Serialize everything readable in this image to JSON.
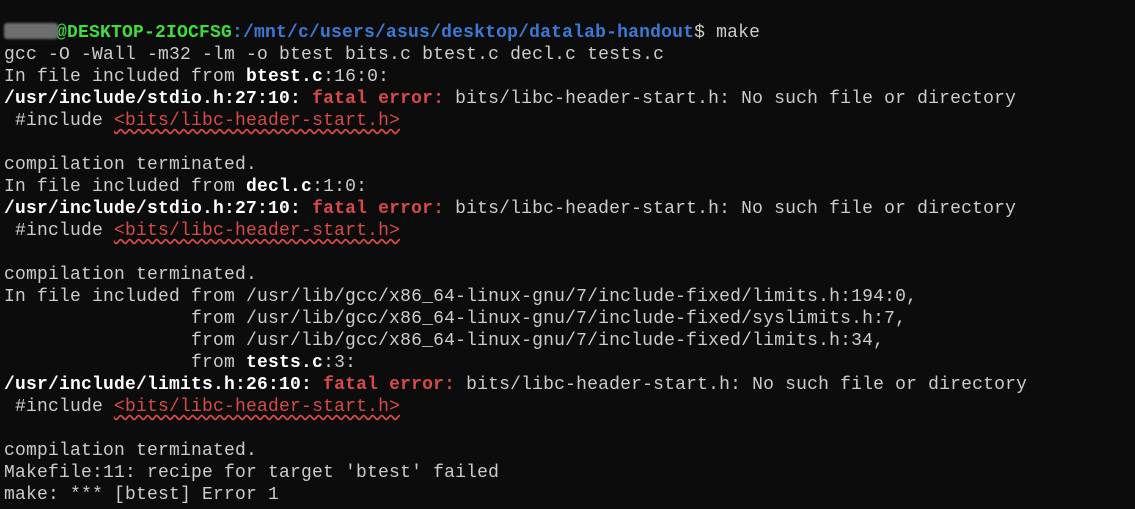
{
  "prompt": {
    "user": "@DESKTOP-2IOCFSG",
    "path": ":/mnt/c/users/asus/desktop/datalab-handout",
    "dollar": "$",
    "command": "make"
  },
  "line2": "gcc -O -Wall -m32 -lm -o btest bits.c btest.c decl.c tests.c",
  "line3a": "In file included from ",
  "line3b": "btest.c",
  "line3c": ":16:0:",
  "line4a": "/usr/include/stdio.h:27:10:",
  "line4b": " fatal error: ",
  "line4c": "bits/libc-header-start.h: No such file or directory",
  "line5a": " #include ",
  "line5b": "<bits/libc-header-start.h>",
  "blank": "",
  "line7": "compilation terminated.",
  "line8a": "In file included from ",
  "line8b": "decl.c",
  "line8c": ":1:0:",
  "line9a": "/usr/include/stdio.h:27:10:",
  "line9b": " fatal error: ",
  "line9c": "bits/libc-header-start.h: No such file or directory",
  "line10a": " #include ",
  "line10b": "<bits/libc-header-start.h>",
  "line12": "compilation terminated.",
  "line13": "In file included from /usr/lib/gcc/x86_64-linux-gnu/7/include-fixed/limits.h:194:0,",
  "line14": "                 from /usr/lib/gcc/x86_64-linux-gnu/7/include-fixed/syslimits.h:7,",
  "line15": "                 from /usr/lib/gcc/x86_64-linux-gnu/7/include-fixed/limits.h:34,",
  "line16a": "                 from ",
  "line16b": "tests.c",
  "line16c": ":3:",
  "line17a": "/usr/include/limits.h:26:10:",
  "line17b": " fatal error: ",
  "line17c": "bits/libc-header-start.h: No such file or directory",
  "line18a": " #include ",
  "line18b": "<bits/libc-header-start.h>",
  "line20": "compilation terminated.",
  "line21": "Makefile:11: recipe for target 'btest' failed",
  "line22": "make: *** [btest] Error 1"
}
